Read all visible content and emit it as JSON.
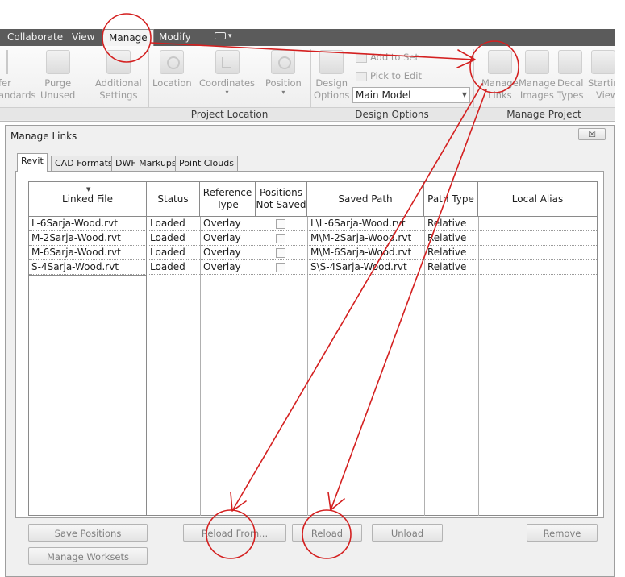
{
  "ribbon": {
    "tabs": [
      "Collaborate",
      "View",
      "Manage",
      "Modify"
    ],
    "active_tab": "Manage",
    "buttons": {
      "transfer_standards": [
        "fer",
        "andards"
      ],
      "purge_unused": [
        "Purge",
        "Unused"
      ],
      "additional_settings": [
        "Additional",
        "Settings"
      ],
      "location": "Location",
      "coordinates": "Coordinates",
      "position": "Position",
      "design_options": [
        "Design",
        "Options"
      ],
      "add_to_set": "Add to Set",
      "pick_to_edit": "Pick to Edit",
      "main_model": "Main Model",
      "manage_links": [
        "Manage",
        "Links"
      ],
      "manage_images": [
        "Manage",
        "Images"
      ],
      "decal_types": [
        "Decal",
        "Types"
      ],
      "starting_view": [
        "Startin",
        "View"
      ]
    },
    "panels": {
      "project_location": "Project Location",
      "design_options": "Design Options",
      "manage_project": "Manage Project"
    }
  },
  "dialog": {
    "title": "Manage Links",
    "close_label": "☒",
    "tabs": [
      "Revit",
      "CAD Formats",
      "DWF Markups",
      "Point Clouds"
    ],
    "active_tab": "Revit",
    "columns": {
      "linked_file": "Linked File",
      "status": "Status",
      "reference_type": [
        "Reference",
        "Type"
      ],
      "positions_not_saved": [
        "Positions",
        "Not Saved"
      ],
      "saved_path": "Saved Path",
      "path_type": "Path Type",
      "local_alias": "Local Alias"
    },
    "rows": [
      {
        "file": "L-6Sarja-Wood.rvt",
        "status": "Loaded",
        "ref": "Overlay",
        "pos_not_saved": false,
        "path": "L\\L-6Sarja-Wood.rvt",
        "path_type": "Relative",
        "alias": ""
      },
      {
        "file": "M-2Sarja-Wood.rvt",
        "status": "Loaded",
        "ref": "Overlay",
        "pos_not_saved": false,
        "path": "M\\M-2Sarja-Wood.rvt",
        "path_type": "Relative",
        "alias": ""
      },
      {
        "file": "M-6Sarja-Wood.rvt",
        "status": "Loaded",
        "ref": "Overlay",
        "pos_not_saved": false,
        "path": "M\\M-6Sarja-Wood.rvt",
        "path_type": "Relative",
        "alias": ""
      },
      {
        "file": "S-4Sarja-Wood.rvt",
        "status": "Loaded",
        "ref": "Overlay",
        "pos_not_saved": false,
        "path": "S\\S-4Sarja-Wood.rvt",
        "path_type": "Relative",
        "alias": ""
      }
    ],
    "buttons": {
      "save_positions": "Save Positions",
      "reload_from": "Reload From...",
      "reload": "Reload",
      "unload": "Unload",
      "remove": "Remove",
      "manage_worksets": "Manage Worksets"
    }
  },
  "annotation_color": "#d42020"
}
